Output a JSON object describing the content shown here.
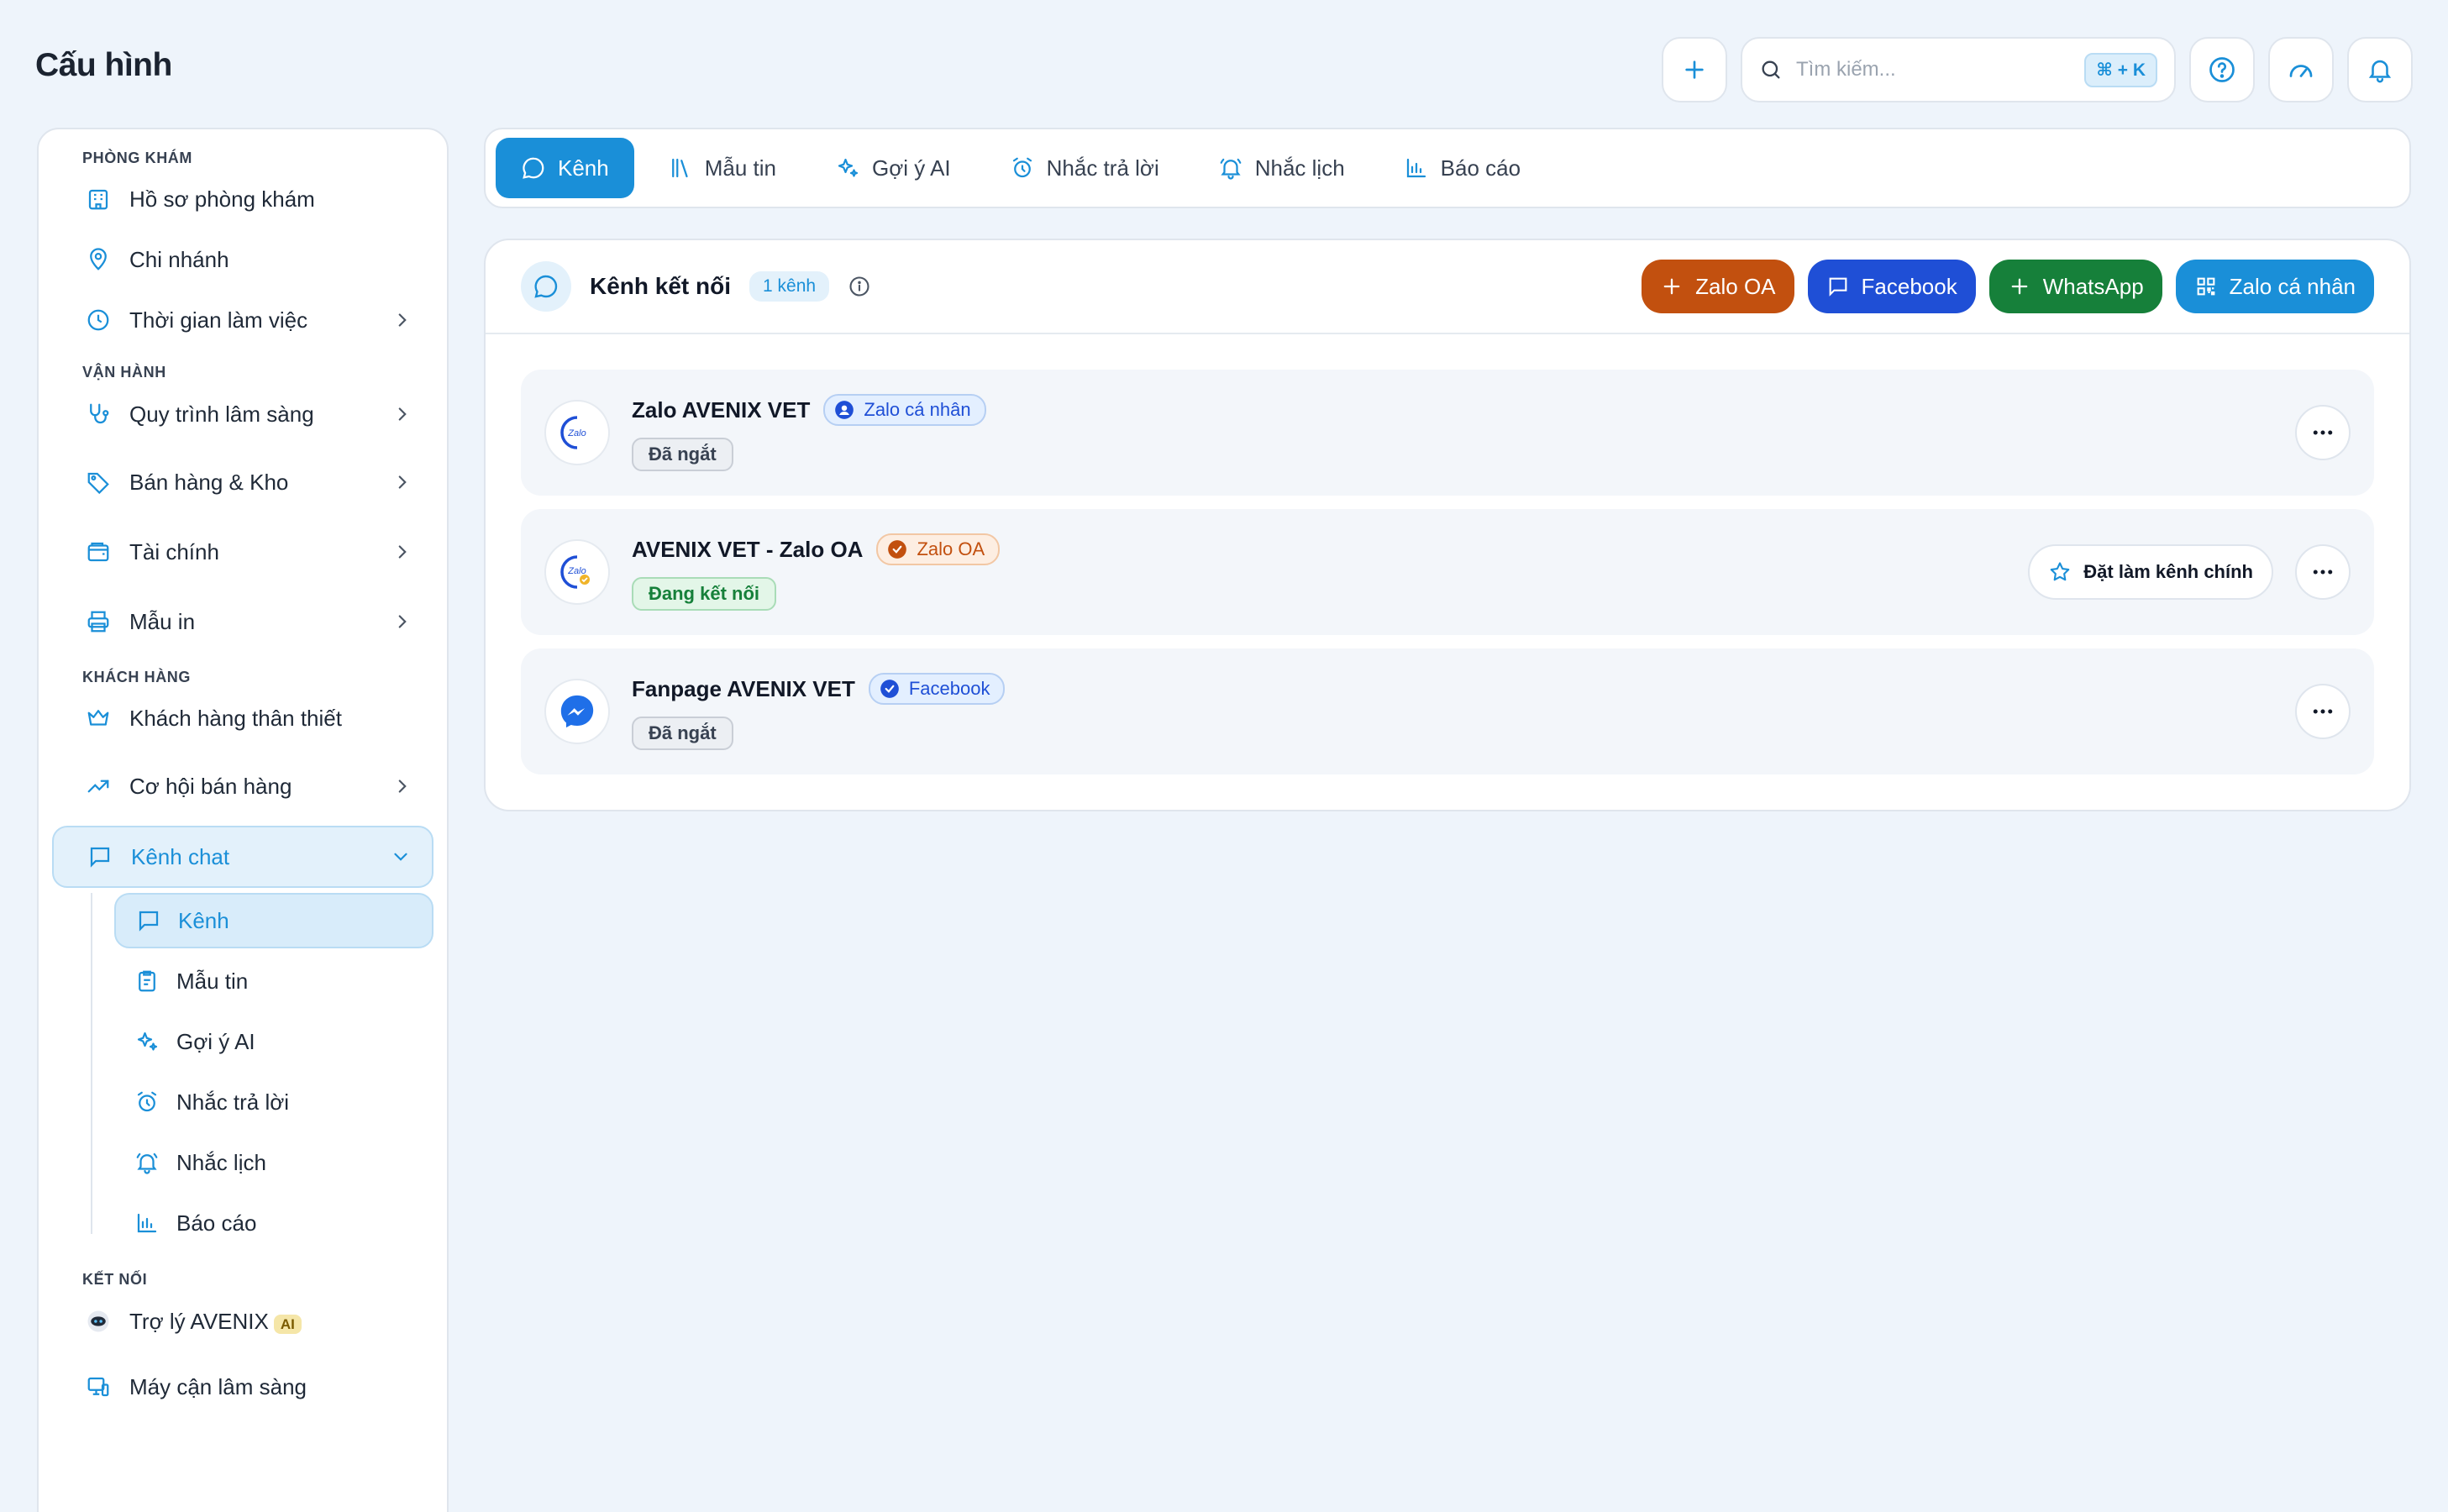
{
  "page": {
    "title": "Cấu hình"
  },
  "topbar": {
    "search_placeholder": "Tìm kiếm...",
    "shortcut": "⌘ + K"
  },
  "sidebar": {
    "sections": {
      "clinic": "PHÒNG KHÁM",
      "operations": "VẬN HÀNH",
      "customers": "KHÁCH HÀNG",
      "connect": "KẾT NỐI"
    },
    "items": {
      "clinic_profile": "Hồ sơ phòng khám",
      "branches": "Chi nhánh",
      "working_hours": "Thời gian làm việc",
      "clinical_flow": "Quy trình lâm sàng",
      "sales_stock": "Bán hàng & Kho",
      "finance": "Tài chính",
      "print_templates": "Mẫu in",
      "loyal_customers": "Khách hàng thân thiết",
      "sales_opportunities": "Cơ hội bán hàng",
      "chat_channels": "Kênh chat",
      "assistant": "Trợ lý AVENIX",
      "assistant_badge": "AI",
      "lab_devices": "Máy cận lâm sàng"
    },
    "sub_items": {
      "channels": "Kênh",
      "message_templates": "Mẫu tin",
      "ai_suggest": "Gợi ý AI",
      "reply_reminder": "Nhắc trả lời",
      "schedule_reminder": "Nhắc lịch",
      "reports": "Báo cáo"
    }
  },
  "tabs": {
    "channels": "Kênh",
    "message_templates": "Mẫu tin",
    "ai_suggest": "Gợi ý AI",
    "reply_reminder": "Nhắc trả lời",
    "schedule_reminder": "Nhắc lịch",
    "reports": "Báo cáo"
  },
  "card": {
    "title": "Kênh kết nối",
    "count": "1 kênh",
    "actions": {
      "zalo_oa": "Zalo OA",
      "facebook": "Facebook",
      "whatsapp": "WhatsApp",
      "zalo_personal": "Zalo cá nhân"
    }
  },
  "channels": [
    {
      "name": "Zalo AVENIX VET",
      "type": "Zalo cá nhân",
      "status": "Đã ngắt"
    },
    {
      "name": "AVENIX VET - Zalo OA",
      "type": "Zalo OA",
      "status": "Đang kết nối",
      "primary_action": "Đặt làm kênh chính"
    },
    {
      "name": "Fanpage AVENIX VET",
      "type": "Facebook",
      "status": "Đã ngắt"
    }
  ],
  "colors": {
    "accent": "#1a8fd8",
    "zalo_oa": "#c2500f",
    "facebook": "#1f4fd6",
    "whatsapp": "#16803a",
    "background": "#eef4fb"
  }
}
